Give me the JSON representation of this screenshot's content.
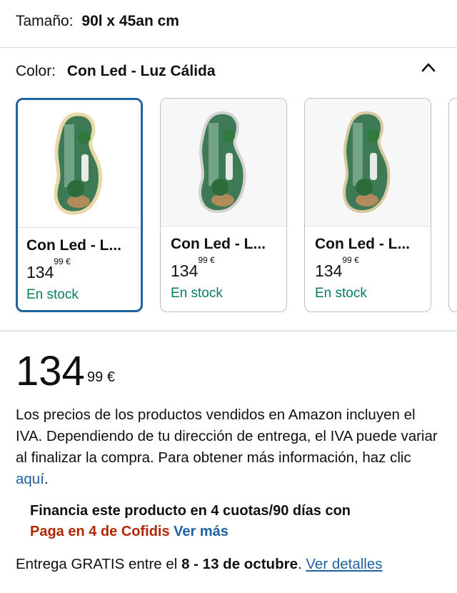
{
  "size": {
    "label": "Tamaño:",
    "value": "90l x 45an cm"
  },
  "color": {
    "label": "Color:",
    "value": "Con Led - Luz Cálida"
  },
  "options": [
    {
      "name": "Con Led - L...",
      "price_whole": "134",
      "price_fraction": "99",
      "currency": "€",
      "stock": "En stock",
      "selected": true
    },
    {
      "name": "Con Led - L...",
      "price_whole": "134",
      "price_fraction": "99",
      "currency": "€",
      "stock": "En stock",
      "selected": false
    },
    {
      "name": "Con Led - L...",
      "price_whole": "134",
      "price_fraction": "99",
      "currency": "€",
      "stock": "En stock",
      "selected": false
    }
  ],
  "price": {
    "whole": "134",
    "fraction": "99",
    "currency": "€"
  },
  "tax_notice": {
    "text": "Los precios de los productos vendidos en Amazon incluyen el IVA. Dependiendo de tu dirección de entrega, el IVA puede variar al finalizar la compra. Para obtener más información, haz clic ",
    "link": "aquí",
    "end": "."
  },
  "financing": {
    "text": "Financia este producto en 4 cuotas/90 días con",
    "brand": "Paga en 4 de Cofidis",
    "more_link": "Ver más"
  },
  "delivery": {
    "prefix": "Entrega GRATIS entre el ",
    "dates": "8 - 13 de octubre",
    "suffix": ".",
    "link": "Ver detalles"
  },
  "colors": {
    "link": "#2162a1",
    "stock": "#067d62",
    "brand": "#b12704",
    "selected_border": "#2162a1"
  }
}
